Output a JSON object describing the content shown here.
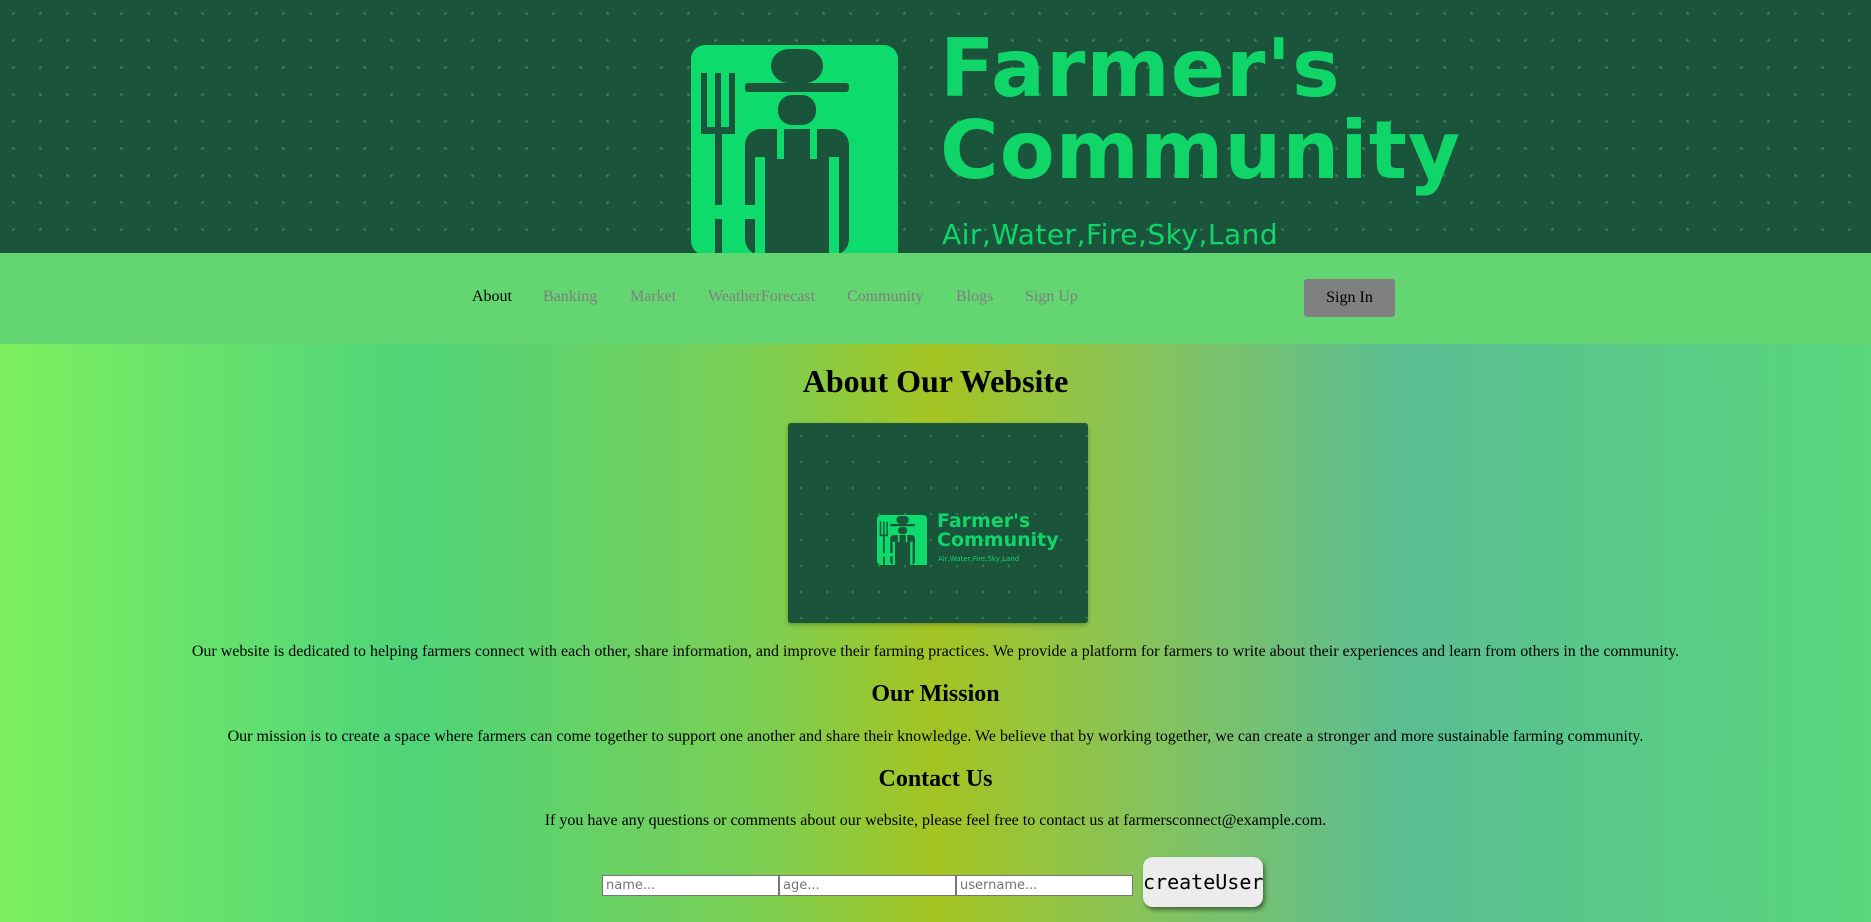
{
  "banner": {
    "logo_title_line1": "Farmer's",
    "logo_title_line2": "Community",
    "logo_tagline": "Air,Water,Fire,Sky,Land",
    "background_color": "#1a543a",
    "logo_color": "#0ddb6b"
  },
  "nav": {
    "items": [
      {
        "label": "About",
        "active": true
      },
      {
        "label": "Banking"
      },
      {
        "label": "Market"
      },
      {
        "label": "WeatherForecast"
      },
      {
        "label": "Community"
      },
      {
        "label": "Blogs"
      },
      {
        "label": "Sign Up"
      }
    ],
    "signin_label": "Sign In",
    "background_color": "#63d672"
  },
  "main": {
    "title": "About Our Website",
    "intro": "Our website is dedicated to helping farmers connect with each other, share information, and improve their farming practices. We provide a platform for farmers to write about their experiences and learn from others in the community.",
    "mission_title": "Our Mission",
    "mission_text": "Our mission is to create a space where farmers can come together to support one another and share their knowledge. We believe that by working together, we can create a stronger and more sustainable farming community.",
    "contact_title": "Contact Us",
    "contact_text": "If you have any questions or comments about our website, please feel free to contact us at farmersconnect@example.com."
  },
  "form": {
    "name_placeholder": "name...",
    "age_placeholder": "age...",
    "username_placeholder": "username...",
    "submit_label": "createUser"
  }
}
